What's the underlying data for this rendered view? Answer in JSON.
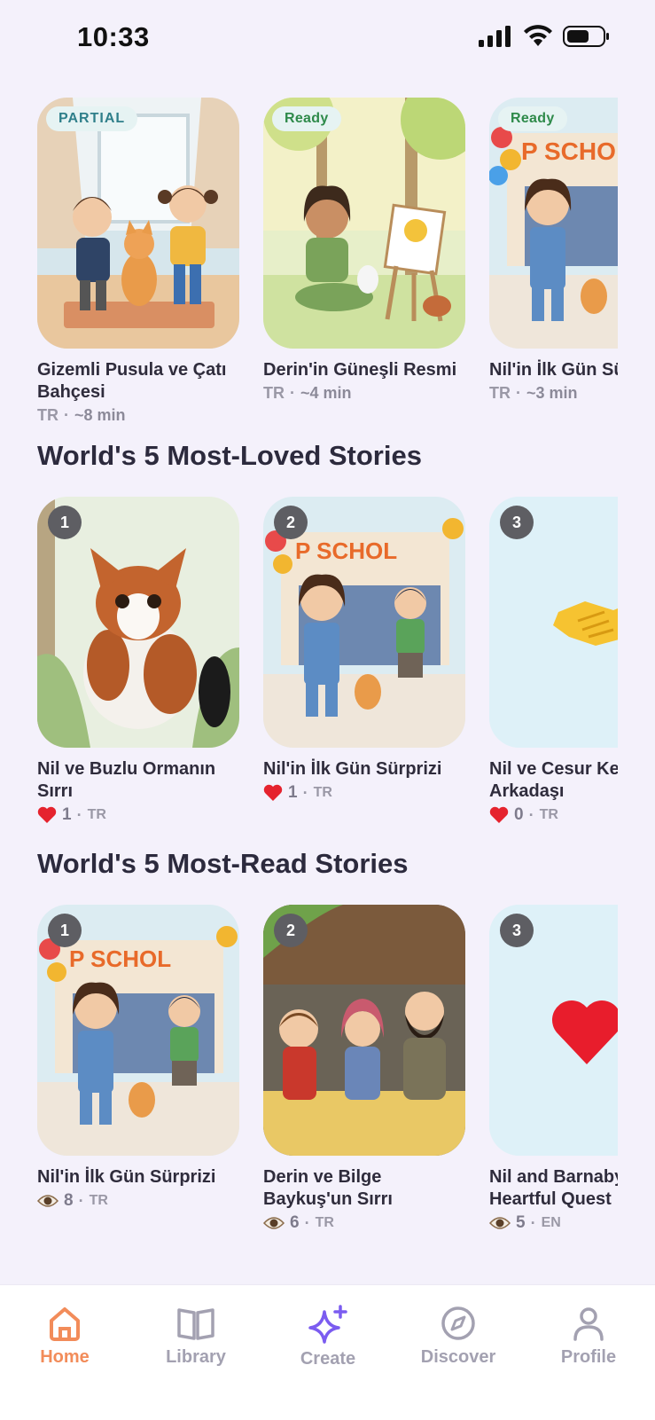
{
  "status_bar": {
    "time": "10:33"
  },
  "recent": {
    "items": [
      {
        "badge": "PARTIAL",
        "title": "Gizemli Pusula ve Çatı Bahçesi",
        "lang": "TR",
        "duration": "~8 min"
      },
      {
        "badge": "Ready",
        "title": "Derin'in Güneşli Resmi",
        "lang": "TR",
        "duration": "~4 min"
      },
      {
        "badge": "Ready",
        "title": "Nil'in İlk Gün Sürprizi",
        "lang": "TR",
        "duration": "~3 min"
      }
    ]
  },
  "most_loved": {
    "title": "World's 5 Most-Loved Stories",
    "items": [
      {
        "rank": "1",
        "title": "Nil ve Buzlu Ormanın Sırrı",
        "count": "1",
        "lang": "TR"
      },
      {
        "rank": "2",
        "title": "Nil'in İlk Gün Sürprizi",
        "count": "1",
        "lang": "TR"
      },
      {
        "rank": "3",
        "title": "Nil ve Cesur Kedi Arkadaşı",
        "count": "0",
        "lang": "TR"
      }
    ]
  },
  "most_read": {
    "title": "World's 5 Most-Read Stories",
    "items": [
      {
        "rank": "1",
        "title": "Nil'in İlk Gün Sürprizi",
        "count": "8",
        "lang": "TR"
      },
      {
        "rank": "2",
        "title": "Derin ve Bilge Baykuş'un Sırrı",
        "count": "6",
        "lang": "TR"
      },
      {
        "rank": "3",
        "title": "Nil and Barnaby's Heartful Quest",
        "count": "5",
        "lang": "EN"
      }
    ]
  },
  "nav": {
    "items": [
      {
        "label": "Home",
        "icon": "home-icon",
        "active": true
      },
      {
        "label": "Library",
        "icon": "book-icon",
        "active": false
      },
      {
        "label": "Create",
        "icon": "sparkle-icon",
        "active": false
      },
      {
        "label": "Discover",
        "icon": "compass-icon",
        "active": false
      },
      {
        "label": "Profile",
        "icon": "person-icon",
        "active": false
      }
    ]
  },
  "colors": {
    "accent": "#f28c5a",
    "create": "#7b5cf0",
    "background": "#f4f1fb",
    "muted": "#a3a1b1"
  },
  "separator": "·"
}
